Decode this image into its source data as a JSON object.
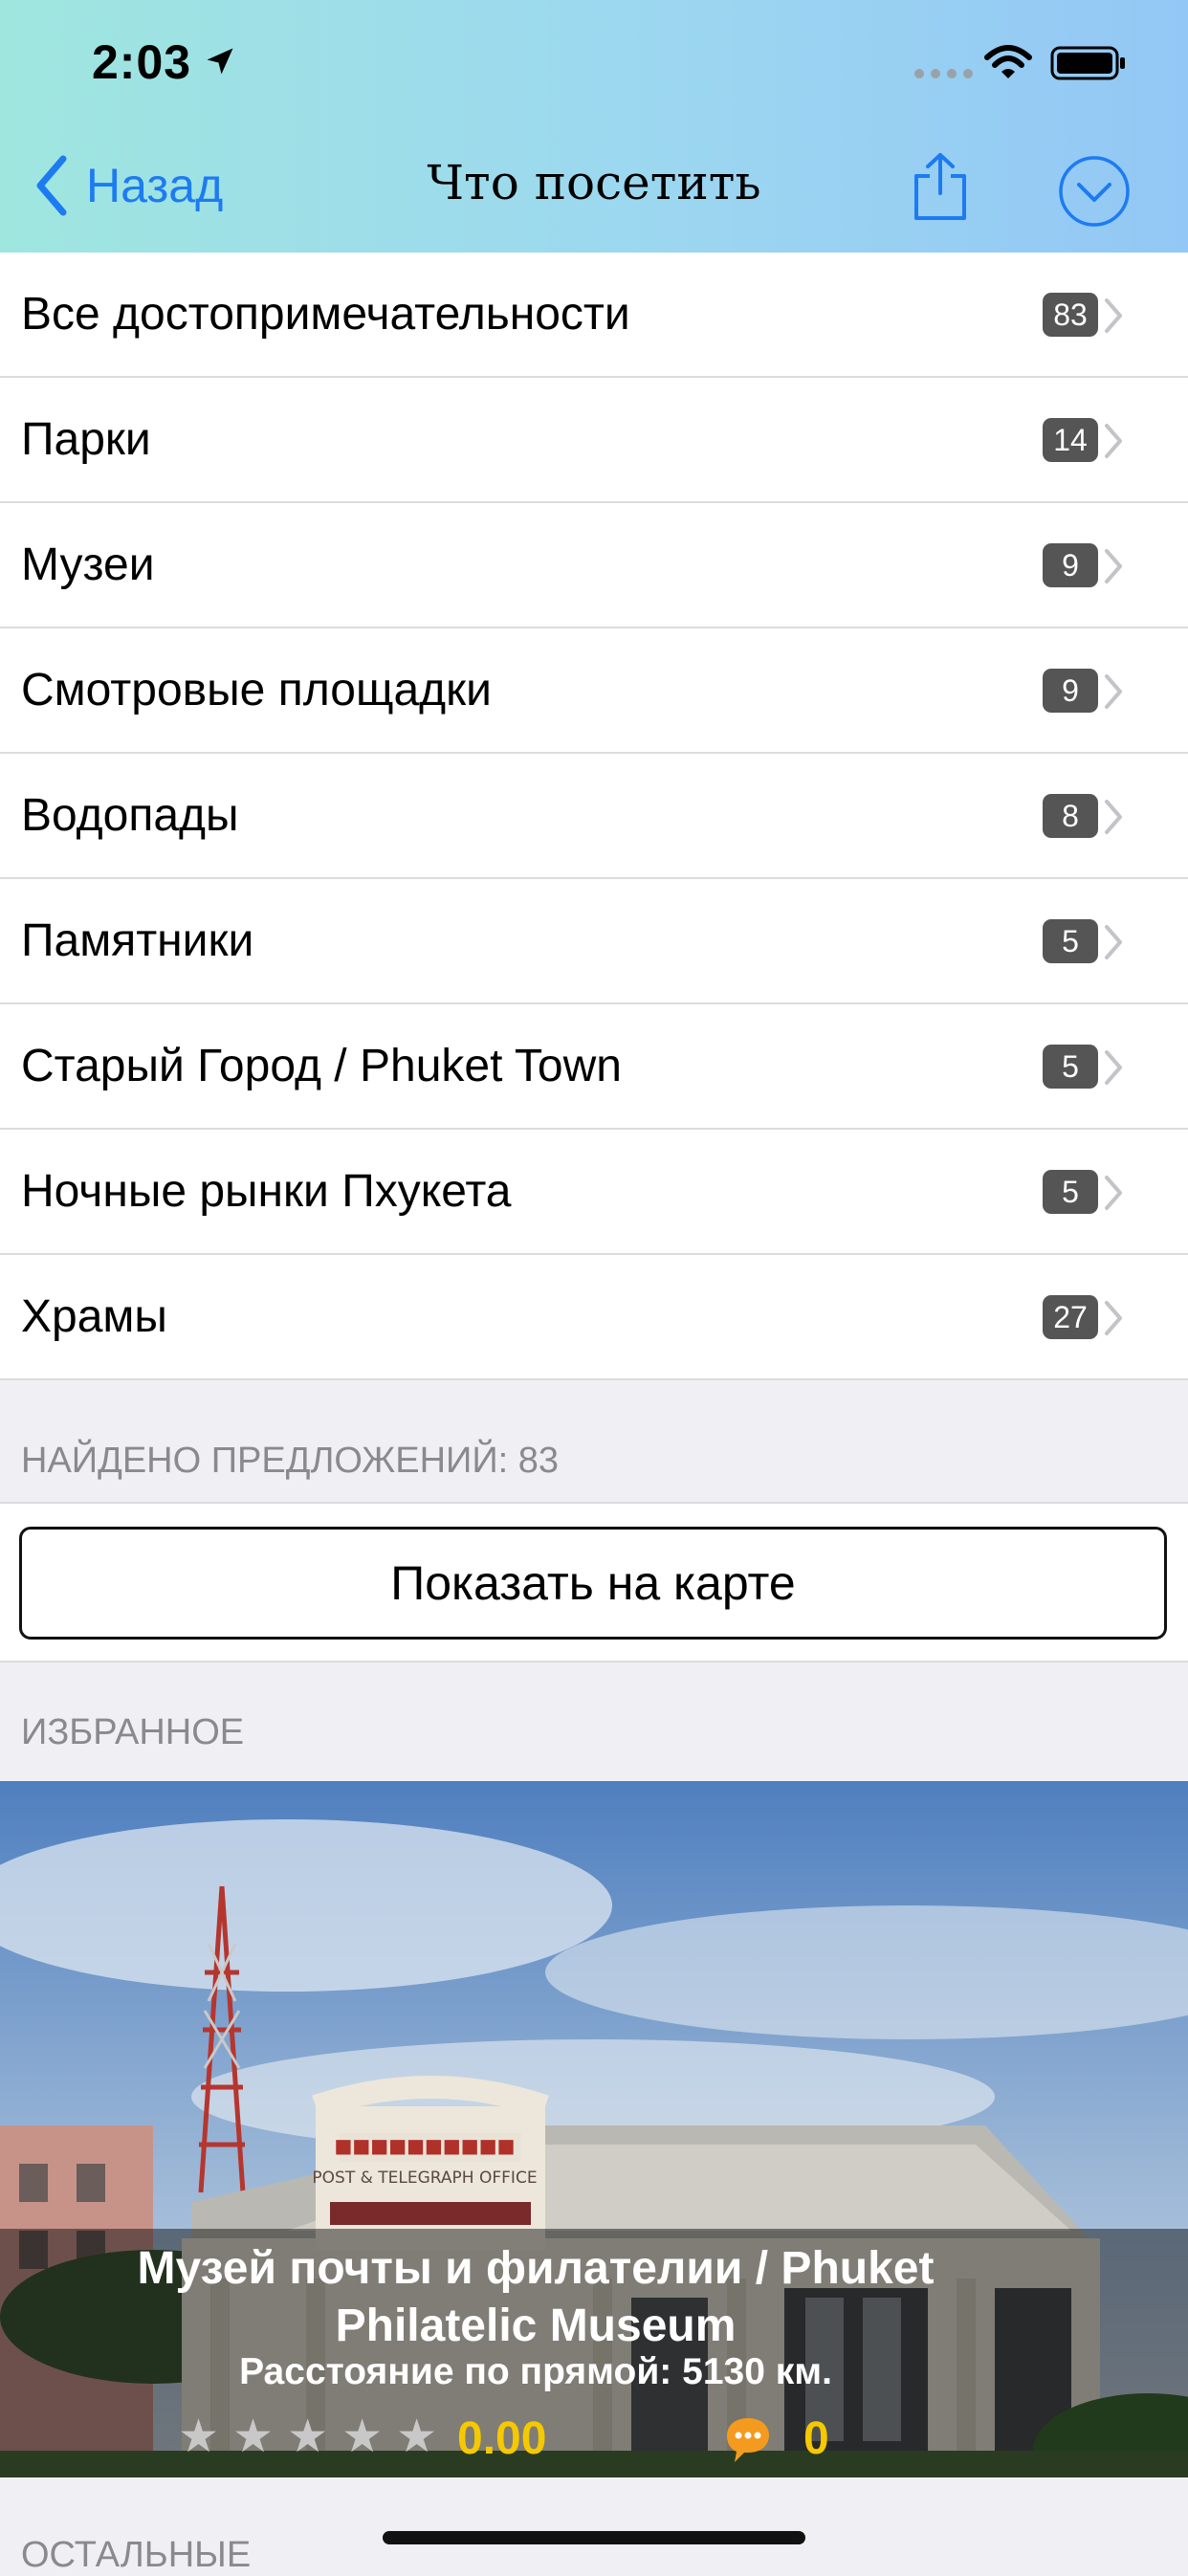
{
  "status_bar": {
    "time": "2:03"
  },
  "nav": {
    "back_label": "Назад",
    "title": "Что посетить"
  },
  "categories": [
    {
      "label": "Все достопримечательности",
      "count": "83"
    },
    {
      "label": "Парки",
      "count": "14"
    },
    {
      "label": "Музеи",
      "count": "9"
    },
    {
      "label": "Смотровые площадки",
      "count": "9"
    },
    {
      "label": "Водопады",
      "count": "8"
    },
    {
      "label": "Памятники",
      "count": "5"
    },
    {
      "label": "Старый Город / Phuket Town",
      "count": "5"
    },
    {
      "label": "Ночные рынки Пхукета",
      "count": "5"
    },
    {
      "label": "Храмы",
      "count": "27"
    }
  ],
  "found": {
    "label": "НАЙДЕНО ПРЕДЛОЖЕНИЙ: 83",
    "map_button": "Показать на карте"
  },
  "favorites": {
    "section_label": "ИЗБРАННОЕ",
    "card": {
      "title": "Музей почты и филателии / Phuket Philatelic Museum",
      "distance": "Расстояние по прямой: 5130 км.",
      "rating": "0.00",
      "comments": "0",
      "stars_filled": 0,
      "stars_total": 5,
      "building_sign": "POST & TELEGRAPH OFFICE"
    }
  },
  "others": {
    "section_label": "ОСТАЛЬНЫЕ"
  },
  "colors": {
    "accent": "#1d7bf2",
    "badge": "#555555",
    "rating": "#f5c800",
    "comment_icon": "#f39a1f"
  }
}
